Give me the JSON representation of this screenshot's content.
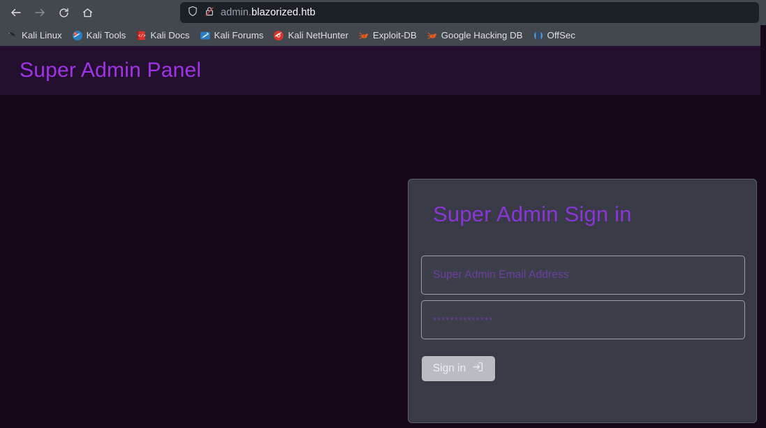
{
  "browser": {
    "nav": {
      "back_icon": "arrow-left-icon",
      "forward_icon": "arrow-right-icon",
      "reload_icon": "reload-icon",
      "home_icon": "home-icon"
    },
    "urlbar": {
      "shield_icon": "shield-icon",
      "lock_icon": "lock-crossed-icon",
      "url_subdomain": "admin.",
      "url_main": "blazorized.htb",
      "full_url": "admin.blazorized.htb"
    },
    "bookmarks": [
      {
        "label": "Kali Linux",
        "icon": "kali-dragon-icon"
      },
      {
        "label": "Kali Tools",
        "icon": "kali-tools-icon"
      },
      {
        "label": "Kali Docs",
        "icon": "kali-docs-book-icon"
      },
      {
        "label": "Kali Forums",
        "icon": "kali-forums-icon"
      },
      {
        "label": "Kali NetHunter",
        "icon": "kali-nethunter-icon"
      },
      {
        "label": "Exploit-DB",
        "icon": "exploit-db-icon"
      },
      {
        "label": "Google Hacking DB",
        "icon": "google-hacking-db-icon"
      },
      {
        "label": "OffSec",
        "icon": "offsec-icon"
      }
    ]
  },
  "page": {
    "header_title": "Super Admin Panel",
    "card": {
      "title": "Super Admin Sign in",
      "email_placeholder": "Super Admin Email Address",
      "email_value": "",
      "password_placeholder": "**************",
      "password_value": "",
      "submit_label": "Sign in",
      "submit_icon": "box-arrow-in-right-icon"
    }
  },
  "colors": {
    "accent_purple": "#a033e8",
    "card_title_purple": "#8a35d8",
    "placeholder_purple": "#6d3f9e",
    "header_band": "#23102e",
    "page_background": "#160a19",
    "card_background": "#383b45",
    "button_background": "#b9bcc1",
    "chrome_background": "#43474e",
    "urlbar_background": "#1c2027"
  }
}
